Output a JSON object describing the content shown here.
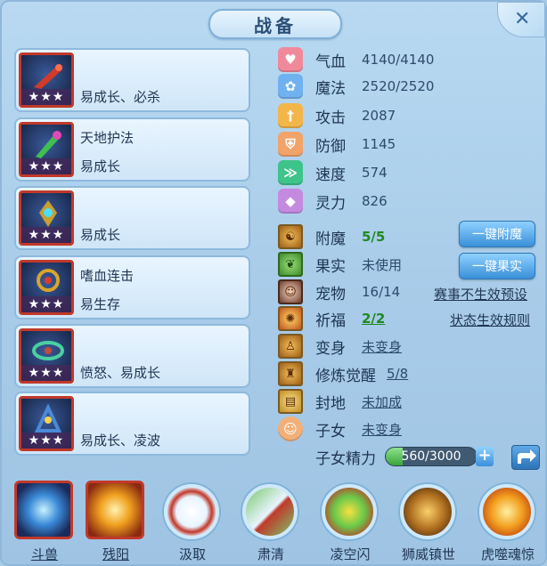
{
  "title": "战备",
  "equipment": [
    {
      "name": "",
      "tags": "易成长、必杀",
      "stars": "★★★",
      "color": "#d23a2a"
    },
    {
      "name": "天地护法",
      "tags": "易成长",
      "stars": "★★★",
      "color": "#3fbf4f"
    },
    {
      "name": "",
      "tags": "易成长",
      "stars": "★★★",
      "color": "#c8a030"
    },
    {
      "name": "嗜血连击",
      "tags": "易生存",
      "stars": "★★★",
      "color": "#d8a52a"
    },
    {
      "name": "",
      "tags": "愤怒、易成长",
      "stars": "★★★",
      "color": "#c44a3a"
    },
    {
      "name": "",
      "tags": "易成长、凌波",
      "stars": "★★★",
      "color": "#4a8ad8"
    }
  ],
  "stats": [
    {
      "label": "气血",
      "value": "4140/4140",
      "icon": "heart-icon",
      "color": "#f08a9a"
    },
    {
      "label": "魔法",
      "value": "2520/2520",
      "icon": "flower-icon",
      "color": "#6fb2ef"
    },
    {
      "label": "攻击",
      "value": "2087",
      "icon": "sword-icon",
      "color": "#f2b64a"
    },
    {
      "label": "防御",
      "value": "1145",
      "icon": "shield-icon",
      "color": "#f2a36a"
    },
    {
      "label": "速度",
      "value": "574",
      "icon": "speed-icon",
      "color": "#3dc48a"
    },
    {
      "label": "灵力",
      "value": "826",
      "icon": "spirit-icon",
      "color": "#c48ae0"
    }
  ],
  "extras": [
    {
      "label": "附魔",
      "value": "5/5"
    },
    {
      "label": "果实",
      "value": "未使用"
    },
    {
      "label": "宠物",
      "value": "16/14"
    },
    {
      "label": "祈福",
      "value": "2/2"
    },
    {
      "label": "变身",
      "value": "未变身"
    },
    {
      "label": "修炼觉醒",
      "value": "5/8"
    },
    {
      "label": "封地",
      "value": "未加成"
    },
    {
      "label": "子女",
      "value": "未变身"
    }
  ],
  "buttons": {
    "enchant": "一键附魔",
    "fruit": "一键果实"
  },
  "links": {
    "event": "赛事不生效预设",
    "rules": "状态生效规则"
  },
  "energy": {
    "label": "子女精力",
    "value": "560/3000",
    "current": 560,
    "max": 3000
  },
  "skills": [
    {
      "label": "斗兽"
    },
    {
      "label": "残阳"
    },
    {
      "label": "汲取"
    },
    {
      "label": "肃清"
    },
    {
      "label": "凌空闪"
    },
    {
      "label": "狮威镇世"
    },
    {
      "label": "虎噬魂惊"
    }
  ]
}
